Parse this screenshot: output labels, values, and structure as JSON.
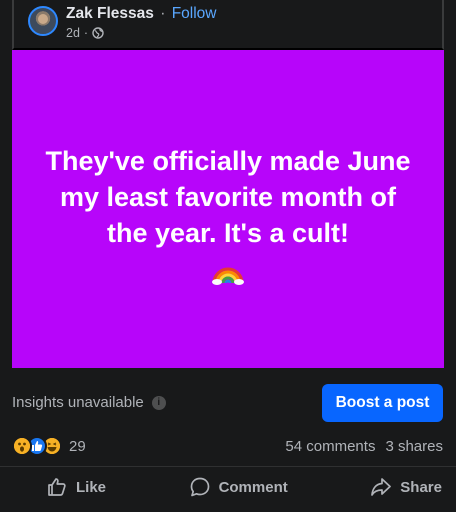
{
  "post": {
    "author_name": "Zak Flessas",
    "separator": "·",
    "follow_label": "Follow",
    "time_ago": "2d",
    "meta_separator": "·",
    "privacy_icon": "globe-icon",
    "background_color": "#b705fa",
    "text": "They've officially made June my least favorite month of the year. It's a cult!",
    "emoji": "rainbow"
  },
  "insights": {
    "label": "Insights unavailable",
    "info_icon": "i"
  },
  "boost": {
    "label": "Boost a post",
    "color": "#0866ff"
  },
  "reactions": {
    "types": [
      "wow",
      "like",
      "haha"
    ],
    "count": "29"
  },
  "stats": {
    "comments": "54 comments",
    "shares": "3 shares"
  },
  "actions": {
    "like": "Like",
    "comment": "Comment",
    "share": "Share"
  }
}
